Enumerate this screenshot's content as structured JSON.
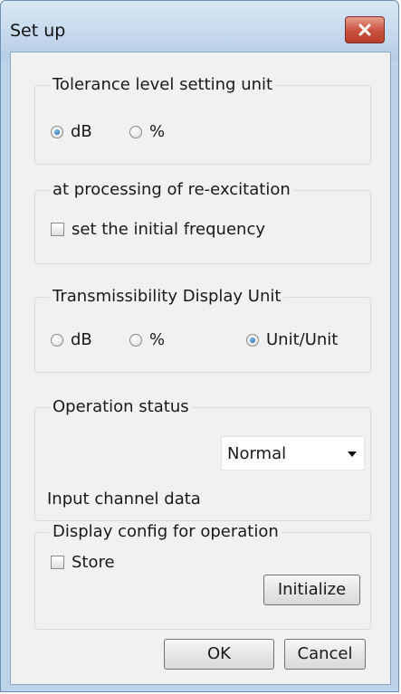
{
  "window": {
    "title": "Set up",
    "close_icon": "close-x-icon"
  },
  "tolerance": {
    "title": "Tolerance level setting unit",
    "options": [
      {
        "label": "dB",
        "checked": true
      },
      {
        "label": "%",
        "checked": false
      }
    ]
  },
  "reexcitation": {
    "title": "at processing of re-excitation",
    "checkbox_label": "set the initial frequency",
    "checked": false
  },
  "transmissibility": {
    "title": "Transmissibility Display Unit",
    "options": [
      {
        "label": "dB",
        "checked": false
      },
      {
        "label": "%",
        "checked": false
      },
      {
        "label": "Unit/Unit",
        "checked": true
      }
    ]
  },
  "operation": {
    "title": "Operation status",
    "input_label": "Input channel data",
    "input_value": "Normal"
  },
  "display_config": {
    "title": "Display config for operation",
    "store_label": "Store",
    "store_checked": false,
    "initialize_label": "Initialize"
  },
  "buttons": {
    "ok": "OK",
    "cancel": "Cancel"
  },
  "colors": {
    "client_bg": "#f1f1f1",
    "frame": "#bdd3ea",
    "close_button": "#c9503c",
    "radio_selected": "#1b5fa5"
  }
}
